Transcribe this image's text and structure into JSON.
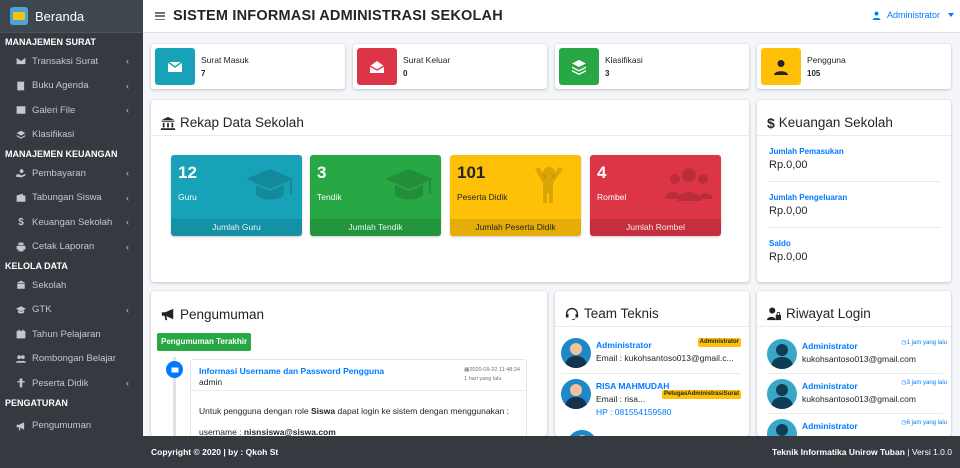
{
  "sidebar": {
    "brand": "Beranda",
    "groups": [
      {
        "header": "MANAJEMEN SURAT",
        "items": [
          {
            "label": "Transaksi Surat",
            "icon": "envelope-icon",
            "chevron": true
          },
          {
            "label": "Buku Agenda",
            "icon": "book-icon",
            "chevron": true
          },
          {
            "label": "Galeri File",
            "icon": "image-icon",
            "chevron": true
          },
          {
            "label": "Klasifikasi",
            "icon": "layers-icon",
            "chevron": false
          }
        ]
      },
      {
        "header": "MANAJEMEN KEUANGAN",
        "items": [
          {
            "label": "Pembayaran",
            "icon": "hand-money-icon",
            "chevron": true
          },
          {
            "label": "Tabungan Siswa",
            "icon": "wallet-icon",
            "chevron": true
          },
          {
            "label": "Keuangan Sekolah",
            "icon": "dollar-icon",
            "chevron": true
          },
          {
            "label": "Cetak Laporan",
            "icon": "print-icon",
            "chevron": true
          }
        ]
      },
      {
        "header": "KELOLA DATA",
        "items": [
          {
            "label": "Sekolah",
            "icon": "school-icon",
            "chevron": false
          },
          {
            "label": "GTK",
            "icon": "graduation-icon",
            "chevron": true
          },
          {
            "label": "Tahun Pelajaran",
            "icon": "calendar-icon",
            "chevron": false
          },
          {
            "label": "Rombongan Belajar",
            "icon": "users-icon",
            "chevron": false
          },
          {
            "label": "Peserta Didik",
            "icon": "child-icon",
            "chevron": true
          }
        ]
      },
      {
        "header": "PENGATURAN",
        "items": [
          {
            "label": "Pengumuman",
            "icon": "bullhorn-icon",
            "chevron": false
          }
        ]
      }
    ]
  },
  "topbar": {
    "title": "SISTEM INFORMASI ADMINISTRASI SEKOLAH",
    "user": "Administrator"
  },
  "info_boxes": [
    {
      "label": "Surat Masuk",
      "value": "7",
      "color": "#17a2b8",
      "icon": "envelope-icon"
    },
    {
      "label": "Surat Keluar",
      "value": "0",
      "color": "#dc3545",
      "icon": "envelope-open-icon"
    },
    {
      "label": "Klasifikasi",
      "value": "3",
      "color": "#28a745",
      "icon": "layers-icon"
    },
    {
      "label": "Pengguna",
      "value": "105",
      "color": "#ffc107",
      "icon": "user-icon"
    }
  ],
  "rekap": {
    "title": "Rekap Data Sekolah",
    "boxes": [
      {
        "value": "12",
        "label": "Guru",
        "footer": "Jumlah Guru",
        "color": "#17a2b8",
        "icon": "graduation-cap-icon"
      },
      {
        "value": "3",
        "label": "Tendik",
        "footer": "Jumlah Tendik",
        "color": "#28a745",
        "icon": "graduation-cap-icon"
      },
      {
        "value": "101",
        "label": "Peserta Didik",
        "footer": "Jumlah Peserta Didik",
        "color": "#ffc107",
        "icon": "child-icon"
      },
      {
        "value": "4",
        "label": "Rombel",
        "footer": "Jumlah Rombel",
        "color": "#dc3545",
        "icon": "users-icon"
      }
    ]
  },
  "keuangan": {
    "title": "Keuangan Sekolah",
    "items": [
      {
        "label": "Jumlah Pemasukan",
        "value": "Rp.0,00"
      },
      {
        "label": "Jumlah Pengeluaran",
        "value": "Rp.0,00"
      },
      {
        "label": "Saldo",
        "value": "Rp.0,00"
      }
    ]
  },
  "pengumuman": {
    "title": "Pengumuman",
    "badge": "Pengumuman Terakhir",
    "item": {
      "title": "Informasi Username dan Password Pengguna",
      "author": "admin",
      "date": "2020-09-22 11:48:24",
      "ago": "1 hari yang lalu",
      "body_line1_pre": "Untuk pengguna dengan role ",
      "body_line1_bold": "Siswa",
      "body_line1_post": " dapat login ke sistem dengan  menggunakan :",
      "body_line2_pre": "username : ",
      "body_line2_bold": "nisnsiswa@siswa.com"
    }
  },
  "team": {
    "title": "Team Teknis",
    "members": [
      {
        "name": "Administrator",
        "badge": "Administrator",
        "line": "Email : kukohsantoso013@gmail.c...",
        "line_blue": false
      },
      {
        "name": "RISA MAHMUDAH",
        "badge": "PetugasAdministrasiSurat",
        "line": "Email : risa...",
        "line2": "HP : 081554159580",
        "line_blue": false
      }
    ]
  },
  "login": {
    "title": "Riwayat Login",
    "entries": [
      {
        "name": "Administrator",
        "email": "kukohsantoso013@gmail.com",
        "ago": "1 jam yang lalu"
      },
      {
        "name": "Administrator",
        "email": "kukohsantoso013@gmail.com",
        "ago": "3 jam yang lalu"
      },
      {
        "name": "Administrator",
        "email": "",
        "ago": "6 jam yang lalu"
      }
    ]
  },
  "footer": {
    "left": "Copyright © 2020 | by : Qkoh St",
    "right_bold": "Teknik Informatika Unirow Tuban",
    "right_rest": " | Versi 1.0.0"
  }
}
